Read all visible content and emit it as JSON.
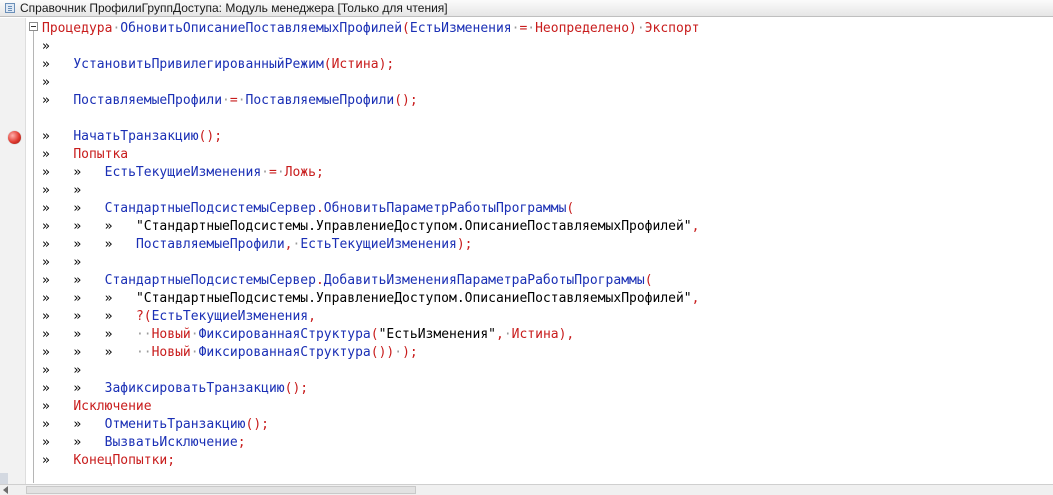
{
  "window": {
    "title": "Справочник ПрофилиГруппДоступа: Модуль менеджера [Только для чтения]"
  },
  "editor": {
    "mode": "read-only",
    "breakpoint_line": 7,
    "lines": [
      [
        [
          "kw",
          "Процедура"
        ],
        [
          "dot",
          "·"
        ],
        [
          "fn",
          "ОбновитьОписаниеПоставляемыхПрофилей"
        ],
        [
          "op",
          "("
        ],
        [
          "fn",
          "ЕстьИзменения"
        ],
        [
          "dot",
          "·"
        ],
        [
          "op",
          "="
        ],
        [
          "dot",
          "·"
        ],
        [
          "kw",
          "Неопределено"
        ],
        [
          "op",
          ")"
        ],
        [
          "dot",
          "·"
        ],
        [
          "kw",
          "Экспорт"
        ]
      ],
      [
        [
          "tab",
          "»"
        ]
      ],
      [
        [
          "tab",
          "»"
        ],
        [
          "sp",
          "   "
        ],
        [
          "fn",
          "УстановитьПривилегированныйРежим"
        ],
        [
          "op",
          "("
        ],
        [
          "kw",
          "Истина"
        ],
        [
          "op",
          ");"
        ]
      ],
      [
        [
          "tab",
          "»"
        ]
      ],
      [
        [
          "tab",
          "»"
        ],
        [
          "sp",
          "   "
        ],
        [
          "fn",
          "ПоставляемыеПрофили"
        ],
        [
          "dot",
          "·"
        ],
        [
          "op",
          "="
        ],
        [
          "dot",
          "·"
        ],
        [
          "fn",
          "ПоставляемыеПрофили"
        ],
        [
          "op",
          "();"
        ]
      ],
      [],
      [
        [
          "tab",
          "»"
        ],
        [
          "sp",
          "   "
        ],
        [
          "fn",
          "НачатьТранзакцию"
        ],
        [
          "op",
          "();"
        ]
      ],
      [
        [
          "tab",
          "»"
        ],
        [
          "sp",
          "   "
        ],
        [
          "kw",
          "Попытка"
        ]
      ],
      [
        [
          "tab",
          "»"
        ],
        [
          "sp",
          "   "
        ],
        [
          "tab",
          "»"
        ],
        [
          "sp",
          "   "
        ],
        [
          "fn",
          "ЕстьТекущиеИзменения"
        ],
        [
          "dot",
          "·"
        ],
        [
          "op",
          "="
        ],
        [
          "dot",
          "·"
        ],
        [
          "kw",
          "Ложь"
        ],
        [
          "op",
          ";"
        ]
      ],
      [
        [
          "tab",
          "»"
        ],
        [
          "sp",
          "   "
        ],
        [
          "tab",
          "»"
        ]
      ],
      [
        [
          "tab",
          "»"
        ],
        [
          "sp",
          "   "
        ],
        [
          "tab",
          "»"
        ],
        [
          "sp",
          "   "
        ],
        [
          "fn",
          "СтандартныеПодсистемыСервер"
        ],
        [
          "op",
          "."
        ],
        [
          "fn",
          "ОбновитьПараметрРаботыПрограммы"
        ],
        [
          "op",
          "("
        ]
      ],
      [
        [
          "tab",
          "»"
        ],
        [
          "sp",
          "   "
        ],
        [
          "tab",
          "»"
        ],
        [
          "sp",
          "   "
        ],
        [
          "tab",
          "»"
        ],
        [
          "sp",
          "   "
        ],
        [
          "str",
          "\"СтандартныеПодсистемы.УправлениеДоступом.ОписаниеПоставляемыхПрофилей\""
        ],
        [
          "op",
          ","
        ]
      ],
      [
        [
          "tab",
          "»"
        ],
        [
          "sp",
          "   "
        ],
        [
          "tab",
          "»"
        ],
        [
          "sp",
          "   "
        ],
        [
          "tab",
          "»"
        ],
        [
          "sp",
          "   "
        ],
        [
          "fn",
          "ПоставляемыеПрофили"
        ],
        [
          "op",
          ","
        ],
        [
          "dot",
          "·"
        ],
        [
          "fn",
          "ЕстьТекущиеИзменения"
        ],
        [
          "op",
          ");"
        ]
      ],
      [
        [
          "tab",
          "»"
        ],
        [
          "sp",
          "   "
        ],
        [
          "tab",
          "»"
        ]
      ],
      [
        [
          "tab",
          "»"
        ],
        [
          "sp",
          "   "
        ],
        [
          "tab",
          "»"
        ],
        [
          "sp",
          "   "
        ],
        [
          "fn",
          "СтандартныеПодсистемыСервер"
        ],
        [
          "op",
          "."
        ],
        [
          "fn",
          "ДобавитьИзмененияПараметраРаботыПрограммы"
        ],
        [
          "op",
          "("
        ]
      ],
      [
        [
          "tab",
          "»"
        ],
        [
          "sp",
          "   "
        ],
        [
          "tab",
          "»"
        ],
        [
          "sp",
          "   "
        ],
        [
          "tab",
          "»"
        ],
        [
          "sp",
          "   "
        ],
        [
          "str",
          "\"СтандартныеПодсистемы.УправлениеДоступом.ОписаниеПоставляемыхПрофилей\""
        ],
        [
          "op",
          ","
        ]
      ],
      [
        [
          "tab",
          "»"
        ],
        [
          "sp",
          "   "
        ],
        [
          "tab",
          "»"
        ],
        [
          "sp",
          "   "
        ],
        [
          "tab",
          "»"
        ],
        [
          "sp",
          "   "
        ],
        [
          "op",
          "?("
        ],
        [
          "fn",
          "ЕстьТекущиеИзменения"
        ],
        [
          "op",
          ","
        ]
      ],
      [
        [
          "tab",
          "»"
        ],
        [
          "sp",
          "   "
        ],
        [
          "tab",
          "»"
        ],
        [
          "sp",
          "   "
        ],
        [
          "tab",
          "»"
        ],
        [
          "sp",
          "   "
        ],
        [
          "dot",
          "··"
        ],
        [
          "kw",
          "Новый"
        ],
        [
          "dot",
          "·"
        ],
        [
          "fn",
          "ФиксированнаяСтруктура"
        ],
        [
          "op",
          "("
        ],
        [
          "str",
          "\"ЕстьИзменения\""
        ],
        [
          "op",
          ","
        ],
        [
          "dot",
          "·"
        ],
        [
          "kw",
          "Истина"
        ],
        [
          "op",
          "),"
        ]
      ],
      [
        [
          "tab",
          "»"
        ],
        [
          "sp",
          "   "
        ],
        [
          "tab",
          "»"
        ],
        [
          "sp",
          "   "
        ],
        [
          "tab",
          "»"
        ],
        [
          "sp",
          "   "
        ],
        [
          "dot",
          "··"
        ],
        [
          "kw",
          "Новый"
        ],
        [
          "dot",
          "·"
        ],
        [
          "fn",
          "ФиксированнаяСтруктура"
        ],
        [
          "op",
          "())"
        ],
        [
          "dot",
          "·"
        ],
        [
          "op",
          ");"
        ]
      ],
      [
        [
          "tab",
          "»"
        ],
        [
          "sp",
          "   "
        ],
        [
          "tab",
          "»"
        ]
      ],
      [
        [
          "tab",
          "»"
        ],
        [
          "sp",
          "   "
        ],
        [
          "tab",
          "»"
        ],
        [
          "sp",
          "   "
        ],
        [
          "fn",
          "ЗафиксироватьТранзакцию"
        ],
        [
          "op",
          "();"
        ]
      ],
      [
        [
          "tab",
          "»"
        ],
        [
          "sp",
          "   "
        ],
        [
          "kw",
          "Исключение"
        ]
      ],
      [
        [
          "tab",
          "»"
        ],
        [
          "sp",
          "   "
        ],
        [
          "tab",
          "»"
        ],
        [
          "sp",
          "   "
        ],
        [
          "fn",
          "ОтменитьТранзакцию"
        ],
        [
          "op",
          "();"
        ]
      ],
      [
        [
          "tab",
          "»"
        ],
        [
          "sp",
          "   "
        ],
        [
          "tab",
          "»"
        ],
        [
          "sp",
          "   "
        ],
        [
          "fn",
          "ВызватьИсключение"
        ],
        [
          "op",
          ";"
        ]
      ],
      [
        [
          "tab",
          "»"
        ],
        [
          "sp",
          "   "
        ],
        [
          "kw",
          "КонецПопытки"
        ],
        [
          "op",
          ";"
        ]
      ]
    ]
  },
  "icons": {
    "window": "document-module-icon",
    "fold": "collapse-minus-icon",
    "breakpoint": "breakpoint-icon",
    "scroll_left": "scroll-left-arrow-icon"
  },
  "colors": {
    "keyword": "#c81c1c",
    "identifier": "#1a2fb5",
    "breakpoint": "#e0392f"
  }
}
